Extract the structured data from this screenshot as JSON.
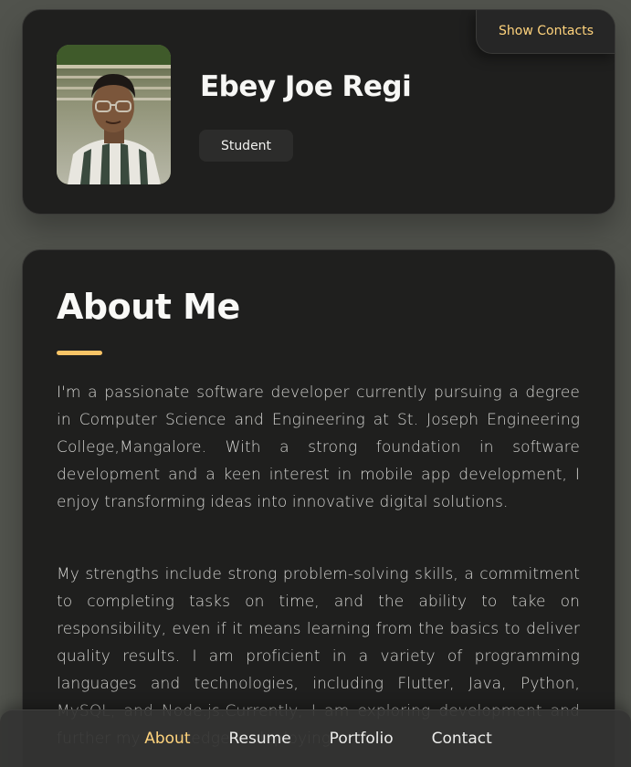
{
  "profile": {
    "name": "Ebey Joe Regi",
    "role": "Student",
    "show_contacts_label": "Show Contacts"
  },
  "about": {
    "title": "About Me",
    "paragraphs": [
      "I'm a passionate software developer currently pursuing a degree in Computer Science and Engineering at St. Joseph Engineering College,Mangalore. With a strong foundation in software development and a keen interest in mobile app development, I enjoy transforming ideas into innovative digital solutions.",
      "My strengths include strong problem-solving skills, a commitment to completing tasks on time, and the ability to take on responsibility, even if it means learning from the basics to deliver quality results. I am proficient in a variety of programming languages and technologies, including Flutter, Java, Python, MySQL, and Node.js.Currently, I am exploring development and further my knowledge in deploying"
    ]
  },
  "navbar": {
    "items": [
      {
        "label": "About",
        "active": true
      },
      {
        "label": "Resume",
        "active": false
      },
      {
        "label": "Portfolio",
        "active": false
      },
      {
        "label": "Contact",
        "active": false
      }
    ]
  },
  "colors": {
    "accent": "#ffd37c",
    "underline": "#f8c466",
    "card_bg": "#1f1f1e",
    "page_bg": "#51534d"
  },
  "icons": {
    "avatar": "profile-photo"
  }
}
